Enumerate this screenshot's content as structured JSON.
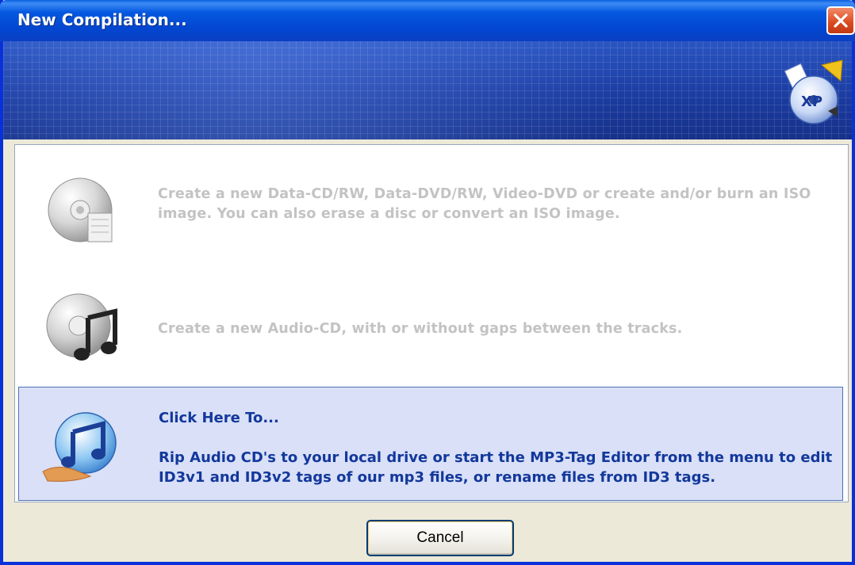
{
  "window": {
    "title": "New Compilation...",
    "close_icon": "close-icon"
  },
  "banner": {
    "logo_icon": "xp-disc-logo-icon",
    "logo_text": "XP"
  },
  "options": [
    {
      "icon": "data-cd-icon",
      "text": "Create a new Data-CD/RW, Data-DVD/RW, Video-DVD or create and/or burn an ISO image. You can also erase a disc or convert an ISO image.",
      "state": "disabled"
    },
    {
      "icon": "audio-cd-icon",
      "text": "Create a new Audio-CD, with or without gaps between the tracks.",
      "state": "disabled"
    },
    {
      "icon": "rip-audio-icon",
      "heading": "Click Here To...",
      "text": "Rip Audio CD's to your local drive or start the MP3-Tag Editor from the menu to edit ID3v1 and ID3v2 tags of our mp3 files, or rename files from ID3 tags.",
      "state": "selected"
    }
  ],
  "buttons": {
    "cancel_label": "Cancel"
  },
  "colors": {
    "titlebar": "#0558e0",
    "disabled_text": "#c3c3c3",
    "active_text": "#13389c",
    "selected_bg": "#d9e0f7"
  }
}
